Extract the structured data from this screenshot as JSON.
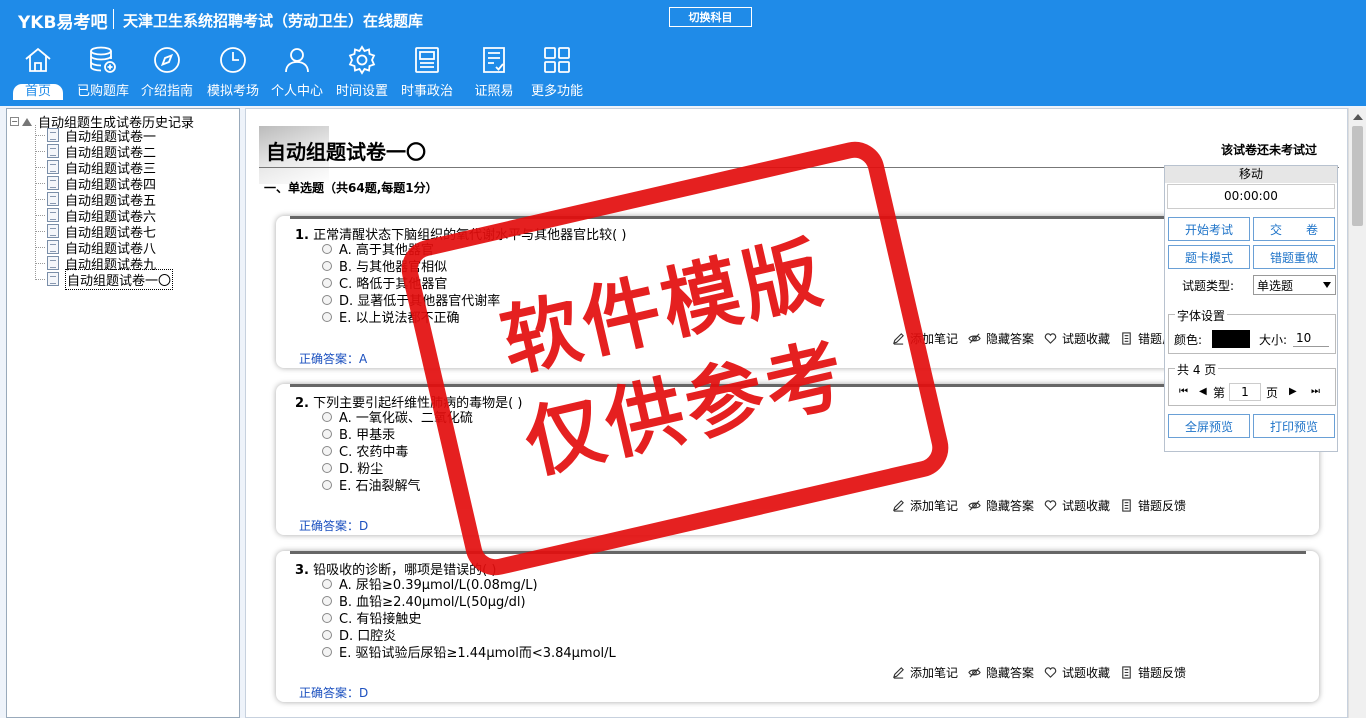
{
  "header": {
    "brand": "YKB易考吧",
    "title": "天津卫生系统招聘考试（劳动卫生）在线题库",
    "switch_label": "切换科目"
  },
  "nav": [
    {
      "label": "首页",
      "icon": "home-icon"
    },
    {
      "label": "已购题库",
      "icon": "database-icon"
    },
    {
      "label": "介绍指南",
      "icon": "compass-icon"
    },
    {
      "label": "模拟考场",
      "icon": "clock-icon"
    },
    {
      "label": "个人中心",
      "icon": "user-icon"
    },
    {
      "label": "时间设置",
      "icon": "gear-icon"
    },
    {
      "label": "时事政治",
      "icon": "newspaper-icon"
    },
    {
      "label": "证照易",
      "icon": "checklist-icon"
    },
    {
      "label": "更多功能",
      "icon": "grid-icon"
    }
  ],
  "tree": {
    "root": "自动组题生成试卷历史记录",
    "items": [
      "自动组题试卷一",
      "自动组题试卷二",
      "自动组题试卷三",
      "自动组题试卷四",
      "自动组题试卷五",
      "自动组题试卷六",
      "自动组题试卷七",
      "自动组题试卷八",
      "自动组题试卷九",
      "自动组题试卷一〇"
    ]
  },
  "paper": {
    "title": "自动组题试卷一〇",
    "status": "该试卷还未考试过",
    "section": "一、单选题（共64题,每题1分）"
  },
  "actions": {
    "note": "添加笔记",
    "hide": "隐藏答案",
    "fav": "试题收藏",
    "report": "错题反馈"
  },
  "questions": [
    {
      "num": "1.",
      "stem": "正常清醒状态下脑组织的氧代谢水平与其他器官比较( )",
      "options": [
        "A. 高于其他器官",
        "B. 与其他器官相似",
        "C. 略低于其他器官",
        "D. 显著低于其他器官代谢率",
        "E. 以上说法都不正确"
      ],
      "answer": "正确答案：A"
    },
    {
      "num": "2.",
      "stem": "下列主要引起纤维性肺病的毒物是( )",
      "options": [
        "A. 一氧化碳、二氧化硫",
        "B. 甲基汞",
        "C. 农药中毒",
        "D. 粉尘",
        "E. 石油裂解气"
      ],
      "answer": "正确答案：D"
    },
    {
      "num": "3.",
      "stem": "铅吸收的诊断，哪项是错误的( )",
      "options": [
        "A. 尿铅≥0.39μmol/L(0.08mg/L)",
        "B. 血铅≥2.40μmol/L(50μg/dl)",
        "C. 有铅接触史",
        "D. 口腔炎",
        "E. 驱铅试验后尿铅≥1.44μmol而<3.84μmol/L"
      ],
      "answer": "正确答案：D"
    }
  ],
  "panel": {
    "move": "移动",
    "timer": "00:00:00",
    "start": "开始考试",
    "submit": "交　　卷",
    "card_mode": "题卡模式",
    "redo_wrong": "错题重做",
    "qtype_label": "试题类型:",
    "qtype_value": "单选题",
    "font_legend": "字体设置",
    "color_label": "颜色:",
    "size_label": "大小:",
    "size_value": "10",
    "font_color": "#000000",
    "pages_legend": "共 4 页",
    "page_prefix": "第",
    "page_value": "1",
    "page_suffix": "页",
    "fullscreen": "全屏预览",
    "print": "打印预览"
  },
  "stamp": {
    "line1": "软件模版",
    "line2": "仅供参考"
  }
}
